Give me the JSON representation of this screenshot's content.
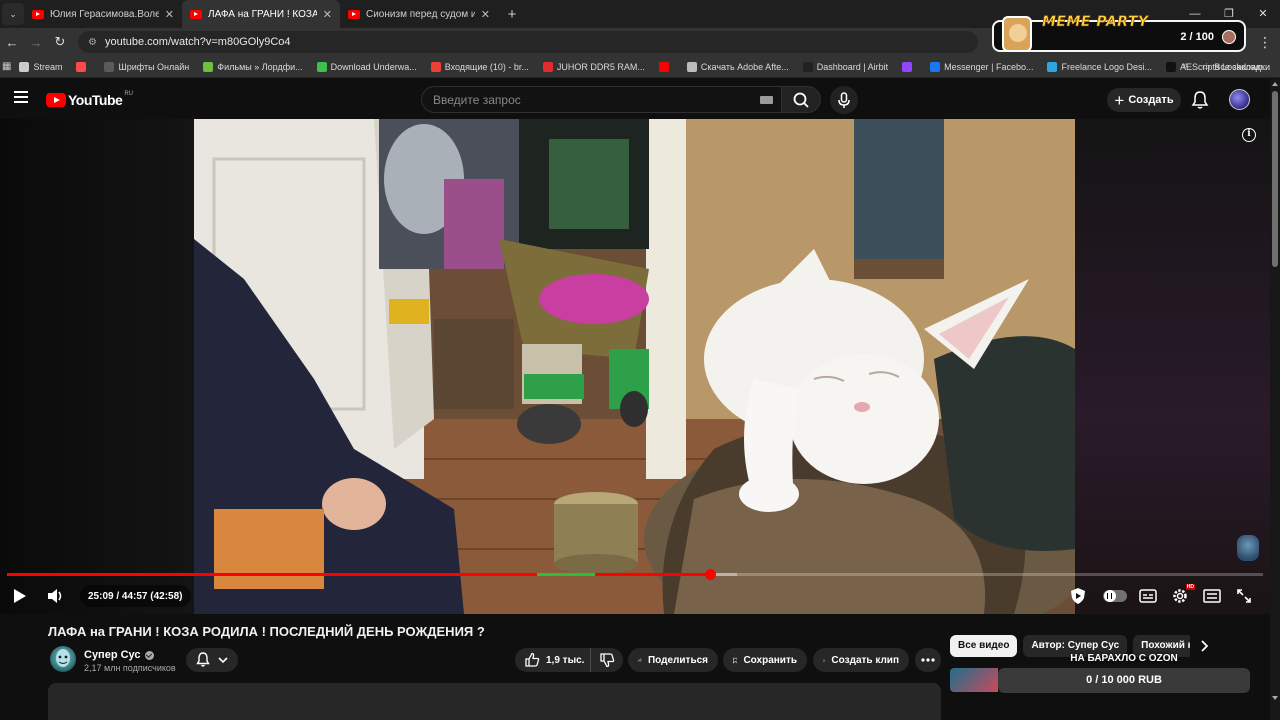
{
  "browser": {
    "tabs": [
      {
        "title": "Юлия Герасимова.Волейбол и",
        "active": false
      },
      {
        "title": "ЛАФА на ГРАНИ ! КОЗА РОДИЛ",
        "active": true
      },
      {
        "title": "Сионизм перед судом истори",
        "active": false
      }
    ],
    "new_tab_label": "+",
    "url": "youtube.com/watch?v=m80GOly9Co4",
    "bookmarks": [
      {
        "label": "Stream",
        "color": "#cccccc"
      },
      {
        "label": "",
        "color": "#ff4a4a"
      },
      {
        "label": "Шрифты Онлайн",
        "color": "#5a5a5a"
      },
      {
        "label": "Фильмы » Лордфи...",
        "color": "#6fbf3f"
      },
      {
        "label": "Download Underwa...",
        "color": "#3cc24a"
      },
      {
        "label": "Входящие (10) - br...",
        "color": "#ea4335"
      },
      {
        "label": "JUHOR DDR5 RAM...",
        "color": "#e22b2b"
      },
      {
        "label": "",
        "color": "#ff0000"
      },
      {
        "label": "Скачать Adobe Afte...",
        "color": "#bbbbbb"
      },
      {
        "label": "Dashboard | Airbit",
        "color": "#222222"
      },
      {
        "label": "",
        "color": "#9146ff"
      },
      {
        "label": "Messenger | Facebo...",
        "color": "#1877f2"
      },
      {
        "label": "Freelance Logo Desi...",
        "color": "#2aa7e0"
      },
      {
        "label": "AEScripts Lockdown...",
        "color": "#111111"
      }
    ],
    "bookmarks_more": "»",
    "all_bookmarks": "Все закладки"
  },
  "overlay": {
    "title": "MEME PARTY",
    "count": "2 / 100"
  },
  "youtube": {
    "logo_text": "YouTube",
    "region": "RU",
    "search_placeholder": "Введите запрос",
    "create_label": "Создать"
  },
  "player": {
    "time": "25:09 / 44:57 (42:58)",
    "progress_played": 0.5595,
    "progress_loaded": 0.581,
    "accent": "#ff0000"
  },
  "video": {
    "title": "ЛАФА на ГРАНИ ! КОЗА РОДИЛА ! ПОСЛЕДНИЙ ДЕНЬ РОЖДЕНИЯ ?",
    "channel": "Супер Сус",
    "subscribers": "2,17 млн подписчиков",
    "likes": "1,9 тыс.",
    "share_label": "Поделиться",
    "save_label": "Сохранить",
    "clip_label": "Создать клип"
  },
  "sidebar": {
    "chips": [
      "Все видео",
      "Автор: Супер Сус",
      "Похожий контент"
    ],
    "donation_title": "НА БАРАХЛО С OZON",
    "donation_amount": "0 / 10 000 RUB"
  }
}
